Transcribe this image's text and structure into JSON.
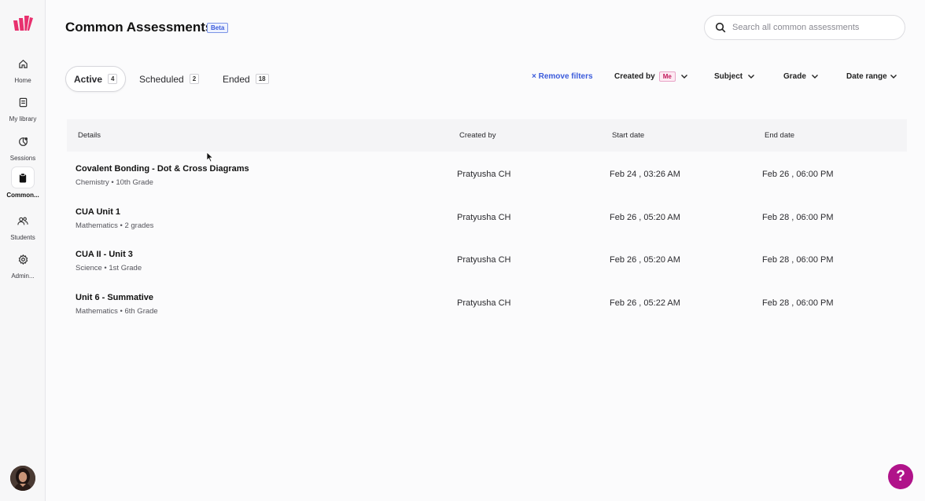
{
  "header": {
    "title": "Common Assessments",
    "beta": "Beta"
  },
  "search": {
    "placeholder": "Search all common assessments",
    "value": ""
  },
  "sidebar": {
    "items": [
      {
        "label": "Home",
        "icon": "home-icon"
      },
      {
        "label": "My library",
        "icon": "library-icon"
      },
      {
        "label": "Sessions",
        "icon": "sessions-icon"
      },
      {
        "label": "Common...",
        "icon": "clipboard-icon",
        "active": true
      },
      {
        "label": "Students",
        "icon": "students-icon"
      },
      {
        "label": "Admin...",
        "icon": "gear-icon"
      }
    ]
  },
  "tabs": [
    {
      "label": "Active",
      "count": "4",
      "active": true
    },
    {
      "label": "Scheduled",
      "count": "2"
    },
    {
      "label": "Ended",
      "count": "18"
    }
  ],
  "filters": {
    "remove": "× Remove filters",
    "created_by": "Created by",
    "me": "Me",
    "subject": "Subject",
    "grade": "Grade",
    "date_range": "Date range"
  },
  "table": {
    "columns": [
      "Details",
      "Created by",
      "Start date",
      "End date"
    ],
    "rows": [
      {
        "title": "Covalent Bonding - Dot & Cross Diagrams",
        "sub": "Chemistry • 10th Grade",
        "created_by": "Pratyusha CH",
        "start": "Feb 24 , 03:26 AM",
        "end": "Feb 26 , 06:00 PM"
      },
      {
        "title": "CUA Unit 1",
        "sub": "Mathematics • 2 grades",
        "created_by": "Pratyusha CH",
        "start": "Feb 26 , 05:20 AM",
        "end": "Feb 28 , 06:00 PM"
      },
      {
        "title": "CUA II - Unit 3",
        "sub": "Science • 1st Grade",
        "created_by": "Pratyusha CH",
        "start": "Feb 26 , 05:20 AM",
        "end": "Feb 28 , 06:00 PM"
      },
      {
        "title": "Unit 6 - Summative",
        "sub": "Mathematics • 6th Grade",
        "created_by": "Pratyusha CH",
        "start": "Feb 26 , 05:22 AM",
        "end": "Feb 28 , 06:00 PM"
      }
    ]
  },
  "help": {
    "label": "?"
  },
  "colors": {
    "brand": "#e8306e",
    "accent": "#3b5bdb",
    "help": "#b0138a"
  }
}
